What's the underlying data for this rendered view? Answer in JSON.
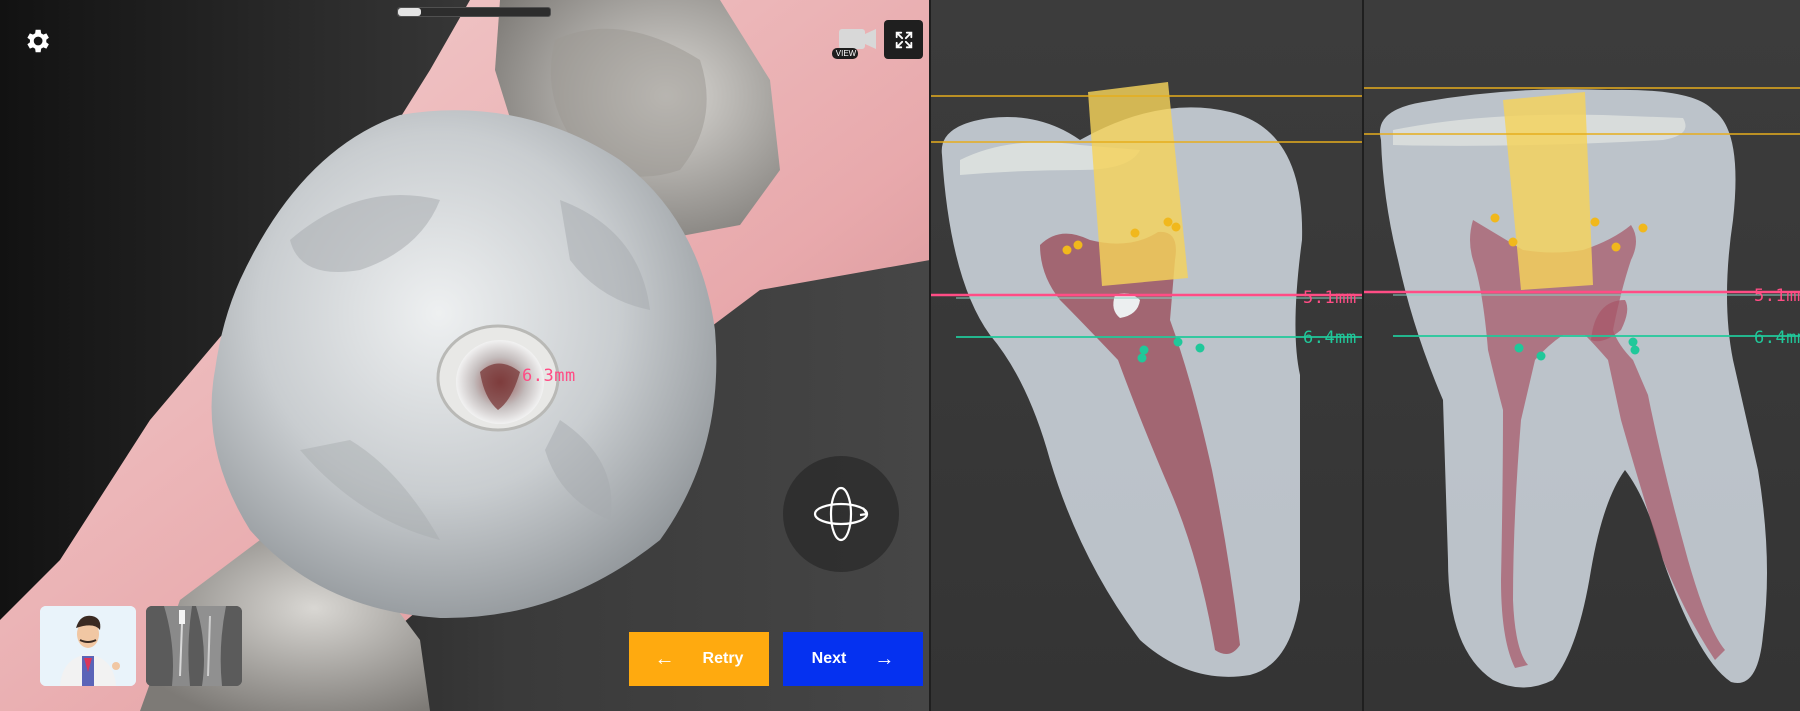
{
  "settings": {
    "icon": "gear-icon"
  },
  "progress": {
    "fraction": 0.15
  },
  "toolbar": {
    "view_label": "VIEW",
    "view_icon": "camera-icon",
    "fullscreen_icon": "fullscreen-icon"
  },
  "main_view": {
    "measure_label": "6.3mm",
    "rotate_icon": "rotate-3d-icon"
  },
  "thumbnails": [
    {
      "name": "doctor-avatar"
    },
    {
      "name": "xray-thumbnail"
    }
  ],
  "buttons": {
    "retry_label": "Retry",
    "next_label": "Next"
  },
  "side_view_1": {
    "pink_label": "5.1mm",
    "green_label": "6.4mm"
  },
  "side_view_2": {
    "pink_label": "5.1mm",
    "green_label": "6.4mm"
  },
  "colors": {
    "retry": "#ffaa0f",
    "next": "#0531f0",
    "measure_pink": "#ff4d85",
    "measure_green": "#20c89a",
    "guide_yellow": "#e6ad1c",
    "access_yellow": "#f5d35a"
  }
}
